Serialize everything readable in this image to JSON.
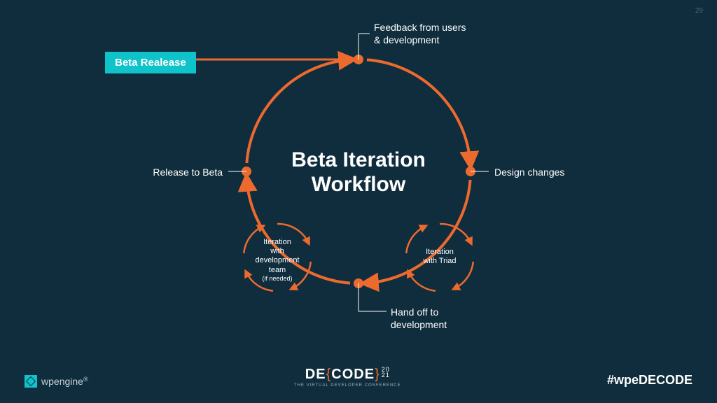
{
  "pageNumber": "29",
  "betaTag": "Beta Realease",
  "centerTitle1": "Beta Iteration",
  "centerTitle2": "Workflow",
  "labels": {
    "feedback1": "Feedback from users",
    "feedback2": "& development",
    "design": "Design changes",
    "handoff1": "Hand off to",
    "handoff2": "development",
    "release": "Release to Beta"
  },
  "miniCircles": {
    "triad1": "Iteration",
    "triad2": "with Triad",
    "dev1": "Iteration",
    "dev2": "with",
    "dev3": "development",
    "dev4": "team",
    "dev5": "(if needed)"
  },
  "footer": {
    "wpEngineLight": "wp",
    "wpEngineBold": "engine",
    "decodeDE": "DE",
    "decodeCODE": "CODE",
    "decodeY1": "20",
    "decodeY2": "21",
    "decodeSub": "THE VIRTUAL DEVELOPER CONFERENCE",
    "hashtag": "#wpeDECODE"
  }
}
